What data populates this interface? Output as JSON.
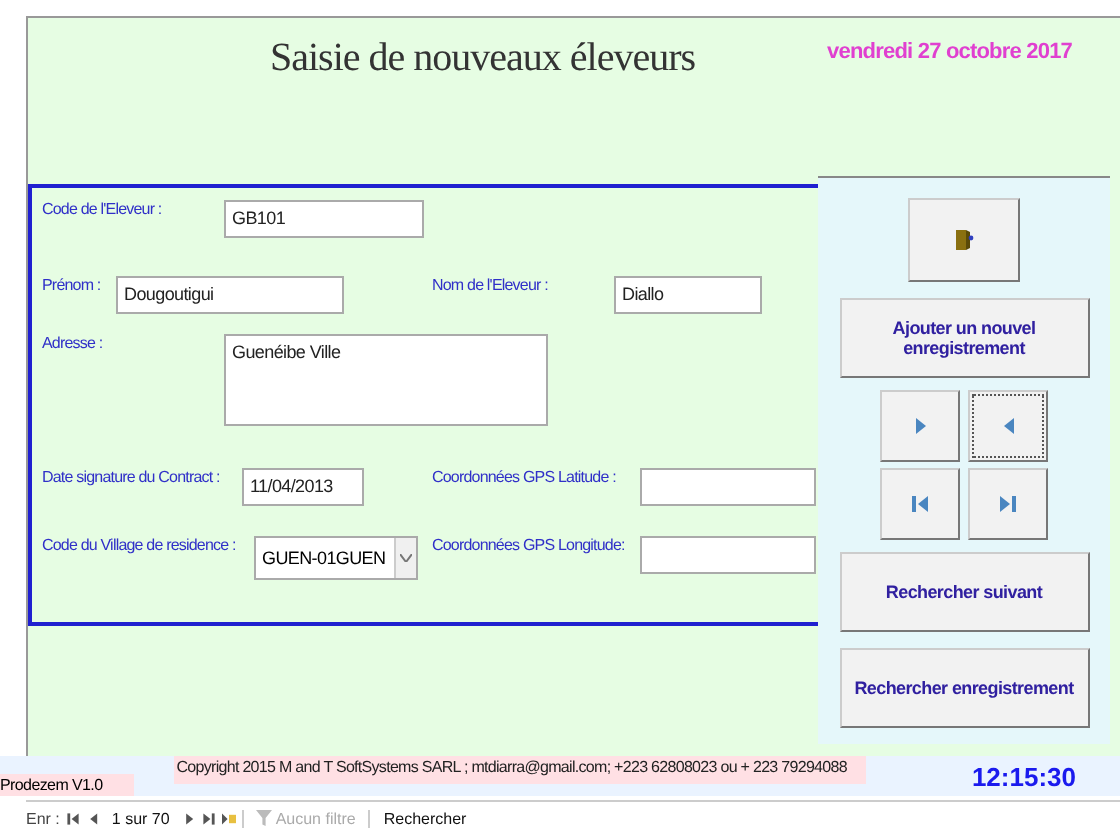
{
  "header": {
    "title": "Saisie de nouveaux éleveurs",
    "date": "vendredi 27 octobre 2017"
  },
  "form": {
    "rows": [
      [
        {
          "label": "Code de l'Eleveur :",
          "value": "GB101",
          "kind": "text"
        }
      ],
      [
        {
          "label": "Prénom :",
          "value": "Dougoutigui",
          "kind": "text"
        },
        {
          "label": "Nom   de l'Eleveur :",
          "value": "Diallo",
          "kind": "text"
        }
      ],
      [
        {
          "label": "Adresse :",
          "value": "Guenéibe Ville",
          "kind": "textarea"
        }
      ],
      [
        {
          "label": "Date signature du Contract :",
          "value": "11/04/2013",
          "kind": "text"
        },
        {
          "label": "Coordonnées GPS Latitude :",
          "kind": "text"
        }
      ],
      [
        {
          "label": "Code du Village de residence :",
          "value": "GUEN-01GUEN",
          "kind": "combo"
        },
        {
          "label": "Coordonnées GPS Longitude:",
          "kind": "text"
        }
      ]
    ]
  },
  "actions": {
    "add_label": "Ajouter  un nouvel enregistrement",
    "nav": [
      {
        "kind": "next",
        "focused": false
      },
      {
        "kind": "prev",
        "focused": true
      },
      {
        "kind": "first",
        "focused": false
      },
      {
        "kind": "last",
        "focused": false
      }
    ],
    "search_next": "Rechercher suivant",
    "search_record": "Rechercher enregistrement"
  },
  "footer": {
    "app_name": "Prodezem V1.0",
    "copyright": "Copyright 2015  M and T SoftSystems SARL ; mtdiarra@gmail.com; +223 62808023 ou + 223 79294088",
    "time": "12:15:30"
  },
  "record_bar": {
    "label": "Enr :",
    "position": "1 sur 70",
    "filter": "Aucun filtre",
    "search": "Rechercher"
  }
}
